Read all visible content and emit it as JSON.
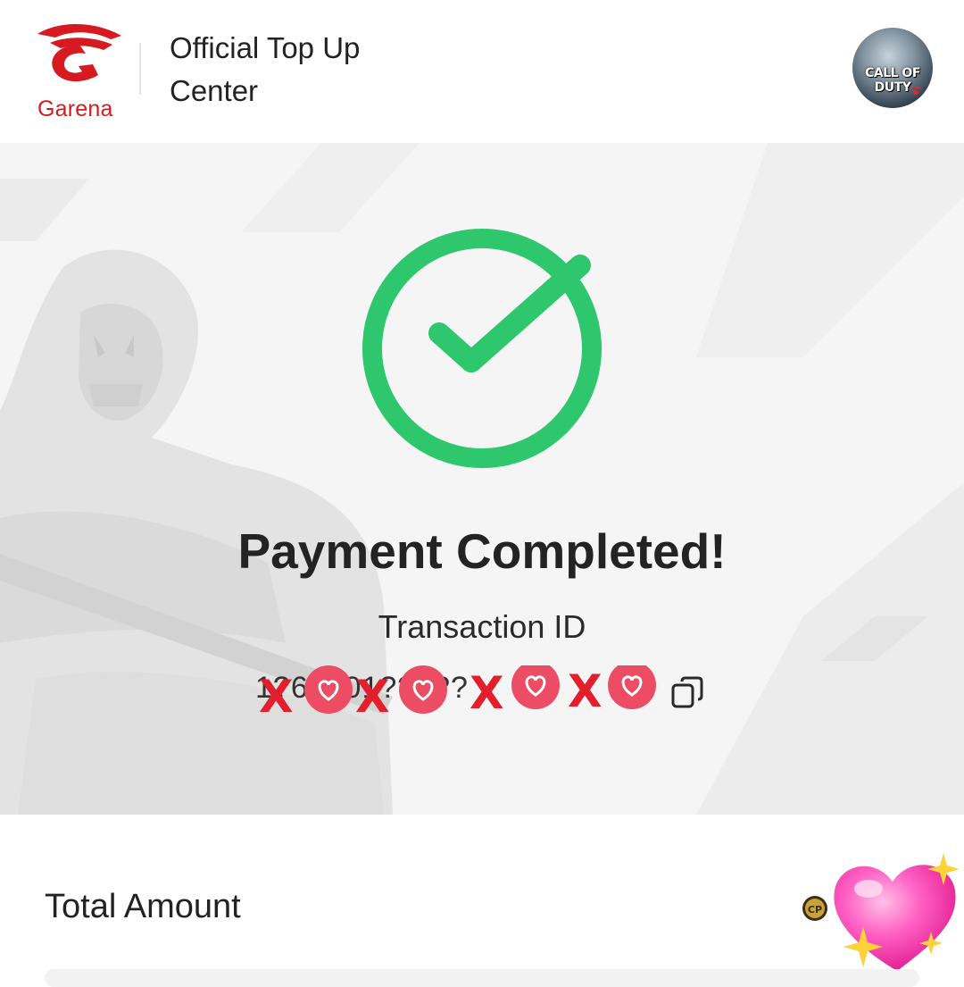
{
  "header": {
    "brand": "Garena",
    "title": "Official Top Up Center",
    "game_avatar_text": "CALL OF DUTY"
  },
  "status": {
    "title": "Payment Completed!",
    "transaction_label": "Transaction ID",
    "transaction_id_visible": "1?6??01??3??"
  },
  "summary": {
    "total_label": "Total Amount",
    "currency_icon": "cp-coin-icon"
  },
  "colors": {
    "brand_red": "#d71920",
    "success_green": "#2ec76d",
    "background": "#f5f5f5"
  }
}
